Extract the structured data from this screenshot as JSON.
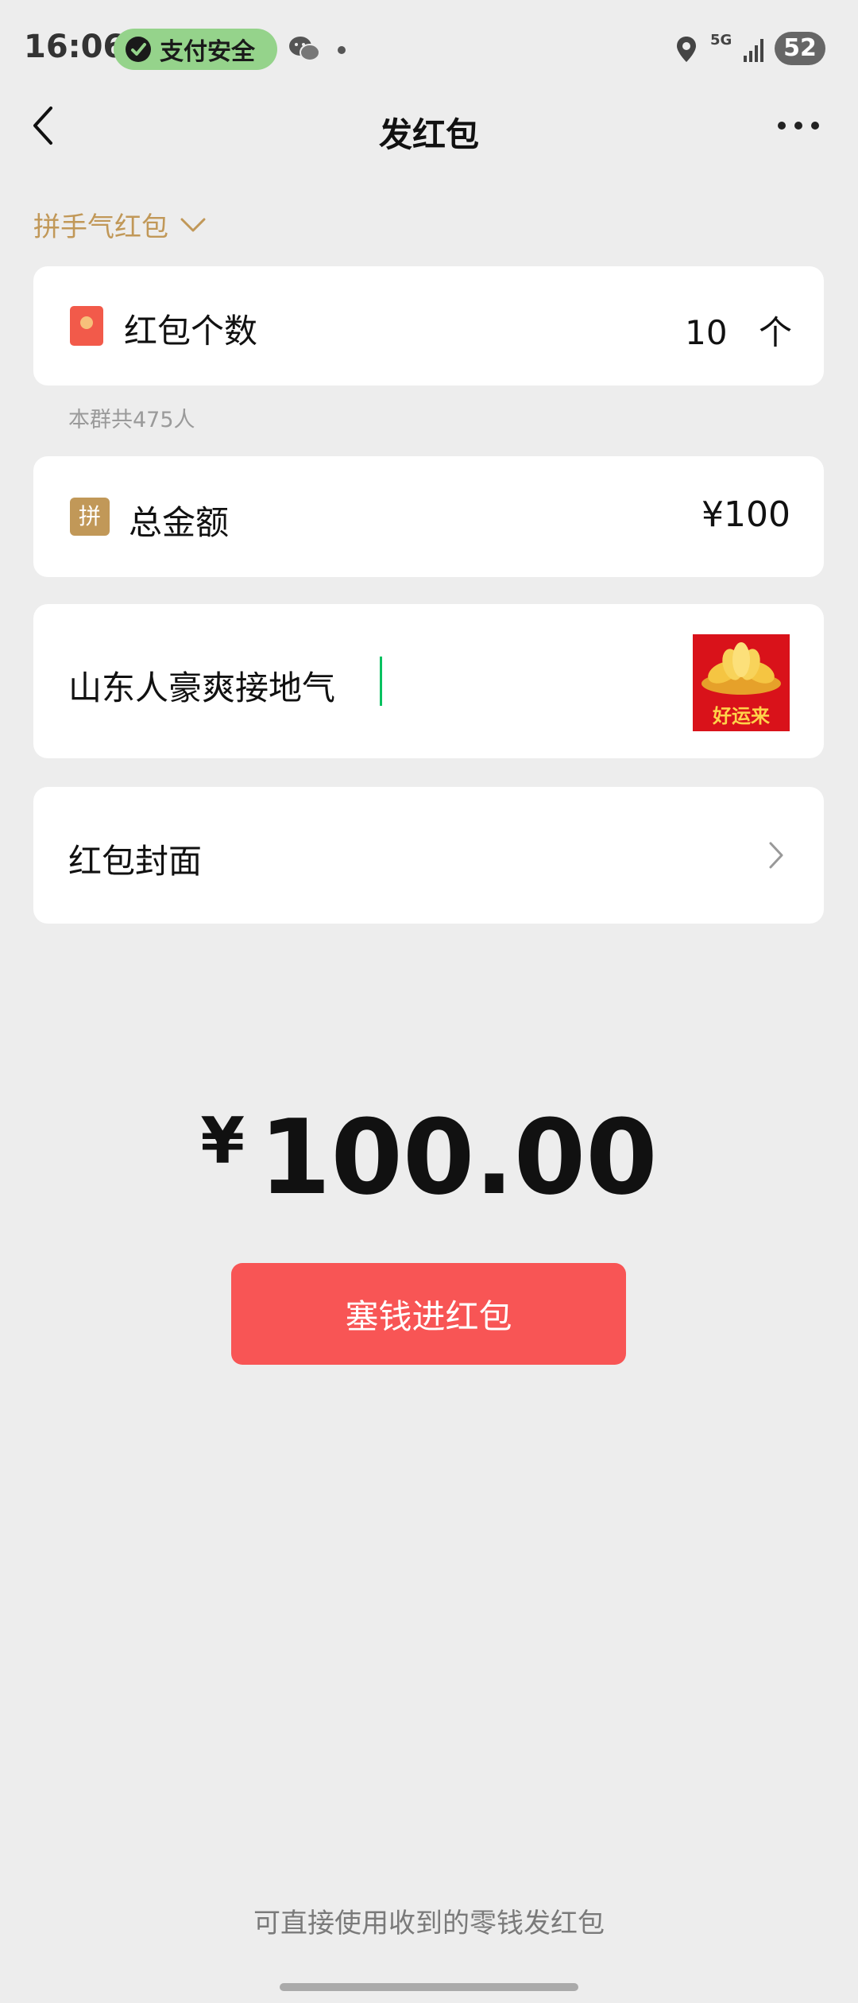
{
  "status_bar": {
    "time": "16:06",
    "pay_badge": "支付安全",
    "network": "5G",
    "battery": "52"
  },
  "nav": {
    "title": "发红包"
  },
  "type_selector": {
    "label": "拼手气红包"
  },
  "packet_count": {
    "label": "红包个数",
    "value": "10",
    "unit": "个"
  },
  "group_note": "本群共475人",
  "total_amount": {
    "icon_text": "拼",
    "label": "总金额",
    "value": "¥100"
  },
  "greeting": {
    "text": "山东人豪爽接地气",
    "sticker_caption": "好运来"
  },
  "cover": {
    "label": "红包封面"
  },
  "total_display": {
    "currency": "¥",
    "amount": "100.00"
  },
  "submit_button": "塞钱进红包",
  "footer_note": "可直接使用收到的零钱发红包",
  "colors": {
    "background": "#ededed",
    "accent_gold": "#c19858",
    "button_red": "#f85555",
    "caret_green": "#07c160",
    "pay_badge_green": "#95d38b"
  }
}
